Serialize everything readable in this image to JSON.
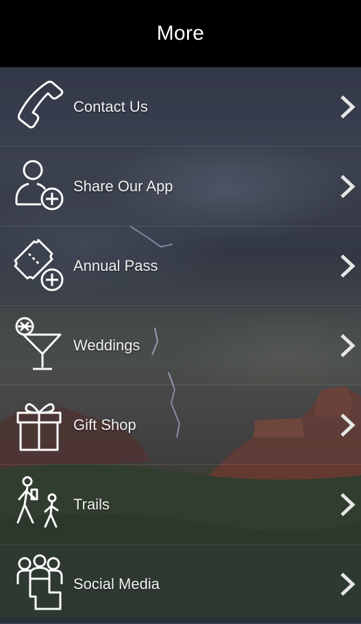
{
  "header": {
    "title": "More"
  },
  "menu": {
    "items": [
      {
        "label": "Contact Us",
        "icon": "phone-icon"
      },
      {
        "label": "Share Our App",
        "icon": "add-user-icon"
      },
      {
        "label": "Annual Pass",
        "icon": "ticket-add-icon"
      },
      {
        "label": "Weddings",
        "icon": "cocktail-icon"
      },
      {
        "label": "Gift Shop",
        "icon": "gift-icon"
      },
      {
        "label": "Trails",
        "icon": "hikers-icon"
      },
      {
        "label": "Social Media",
        "icon": "group-icon"
      }
    ]
  },
  "colors": {
    "header_bg": "#000000",
    "text": "#f2f2f2",
    "chevron": "#e6e6e6"
  }
}
